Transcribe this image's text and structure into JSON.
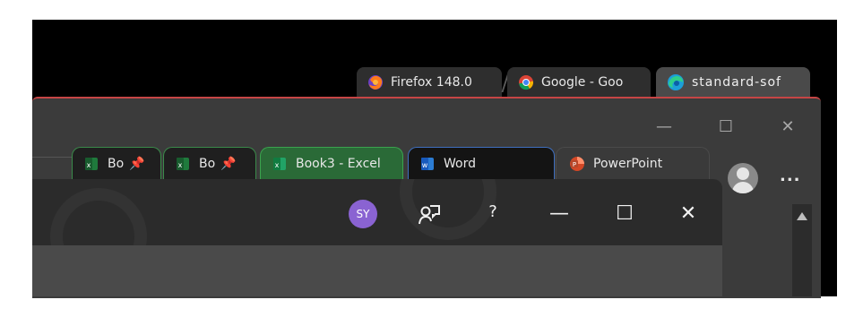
{
  "browser_tabs": [
    {
      "label": "Firefox 148.0",
      "icon": "firefox-icon"
    },
    {
      "label": "Google - Goo",
      "icon": "chrome-icon"
    },
    {
      "label": "standard-sof",
      "icon": "edge-icon",
      "active": true
    }
  ],
  "edge_window": {
    "controls": {
      "minimize": "—",
      "maximize": "☐",
      "close": "✕"
    },
    "more_label": "..."
  },
  "office_tabs": [
    {
      "label": "Bo",
      "app": "excel",
      "pinned": true
    },
    {
      "label": "Bo",
      "app": "excel",
      "pinned": true
    },
    {
      "label": "Book3 - Excel",
      "app": "excel",
      "active": true
    },
    {
      "label": "Word",
      "app": "word"
    },
    {
      "label": "PowerPoint",
      "app": "powerpoint"
    }
  ],
  "office_window": {
    "avatar_initials": "SY",
    "help_label": "?",
    "controls": {
      "minimize": "—",
      "maximize": "☐",
      "close": "✕"
    }
  },
  "colors": {
    "excel": "#1f7a3c",
    "word": "#2b5fb8",
    "powerpoint": "#d24726",
    "avatar": "#8a63d2",
    "edge_accent": "#c64545"
  }
}
